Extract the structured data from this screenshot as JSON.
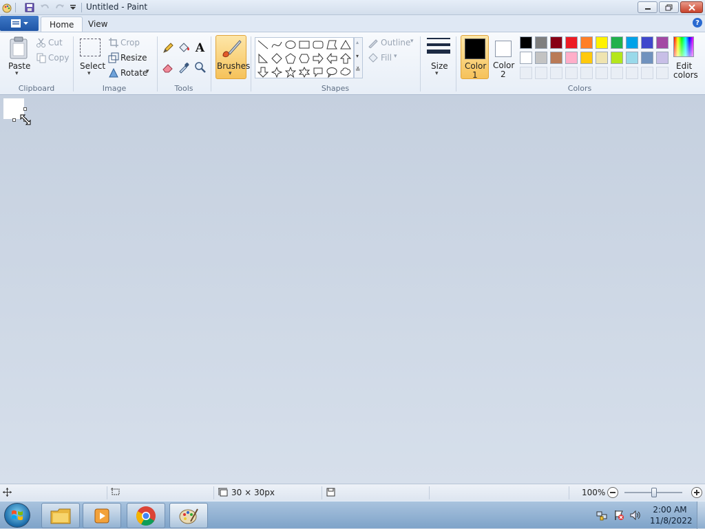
{
  "window": {
    "title": "Untitled - Paint"
  },
  "tabs": {
    "home": "Home",
    "view": "View"
  },
  "ribbon": {
    "clipboard": {
      "paste": "Paste",
      "cut": "Cut",
      "copy": "Copy",
      "label": "Clipboard"
    },
    "image": {
      "select": "Select",
      "crop": "Crop",
      "resize": "Resize",
      "rotate": "Rotate",
      "label": "Image"
    },
    "tools": {
      "label": "Tools"
    },
    "brushes": "Brushes",
    "shapes": {
      "outline": "Outline",
      "fill": "Fill",
      "label": "Shapes"
    },
    "size": "Size",
    "colors": {
      "color1_line1": "Color",
      "color1_line2": "1",
      "color2_line1": "Color",
      "color2_line2": "2",
      "edit_line1": "Edit",
      "edit_line2": "colors",
      "label": "Colors",
      "color1_value": "#000000",
      "color2_value": "#ffffff",
      "palette_row1": [
        "#000000",
        "#7f7f7f",
        "#880015",
        "#ed1c24",
        "#ff7f27",
        "#fff200",
        "#22b14c",
        "#00a2e8",
        "#3f48cc",
        "#a349a4"
      ],
      "palette_row2": [
        "#ffffff",
        "#c3c3c3",
        "#b97a57",
        "#ffaec9",
        "#ffc90e",
        "#efe4b0",
        "#b5e61d",
        "#99d9ea",
        "#7092be",
        "#c8bfe7"
      ]
    }
  },
  "status": {
    "canvas_size": "30 × 30px",
    "zoom": "100%"
  },
  "taskbar": {
    "time": "2:00 AM",
    "date": "11/8/2022"
  }
}
